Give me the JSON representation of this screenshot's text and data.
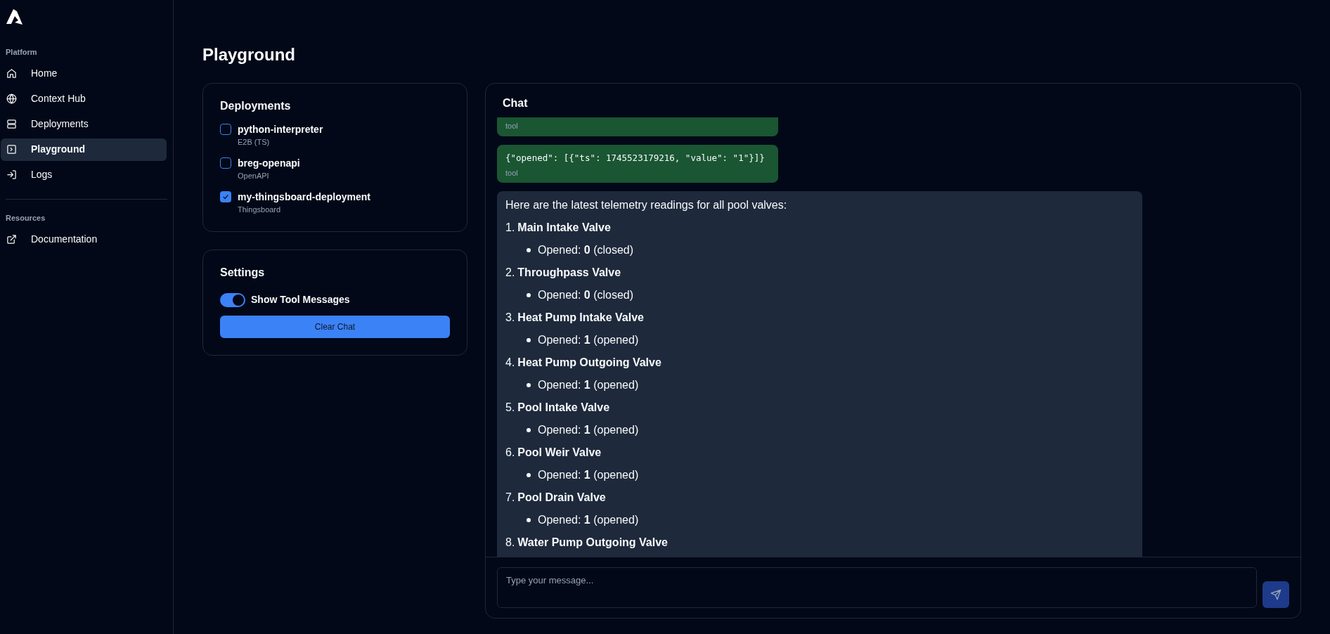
{
  "sidebar": {
    "sections": [
      {
        "title": "Platform",
        "items": [
          {
            "label": "Home",
            "kind": "home",
            "selected": false
          },
          {
            "label": "Context Hub",
            "kind": "globe",
            "selected": false
          },
          {
            "label": "Deployments",
            "kind": "server",
            "selected": false
          },
          {
            "label": "Playground",
            "kind": "terminal",
            "selected": true
          },
          {
            "label": "Logs",
            "kind": "login",
            "selected": false
          }
        ]
      },
      {
        "title": "Resources",
        "items": [
          {
            "label": "Documentation",
            "kind": "external",
            "selected": false
          }
        ]
      }
    ]
  },
  "page_title": "Playground",
  "deployments": {
    "title": "Deployments",
    "items": [
      {
        "name": "python-interpreter",
        "type": "E2B (TS)",
        "checked": false
      },
      {
        "name": "breg-openapi",
        "type": "OpenAPI",
        "checked": false
      },
      {
        "name": "my-thingsboard-deployment",
        "type": "Thingsboard",
        "checked": true
      }
    ]
  },
  "settings": {
    "title": "Settings",
    "toggle": {
      "label": "Show Tool Messages",
      "on": true
    },
    "button": "Clear Chat"
  },
  "chat": {
    "title": "Chat",
    "messages": [
      {
        "kind": "tool",
        "role": "tool"
      },
      {
        "kind": "tool",
        "content": "{\"opened\": [{\"ts\": 1745523179216, \"value\": \"1\"}]}",
        "role": "tool"
      },
      {
        "kind": "assistant",
        "intro": "Here are the latest telemetry readings for all pool valves:",
        "items": [
          {
            "number": "1.",
            "name": "Main Intake Valve",
            "detail": "Opened: **0** (closed)"
          },
          {
            "number": "2.",
            "name": "Throughpass Valve",
            "detail": "Opened: **0** (closed)"
          },
          {
            "number": "3.",
            "name": "Heat Pump Intake Valve",
            "detail": "Opened: **1** (opened)"
          },
          {
            "number": "4.",
            "name": "Heat Pump Outgoing Valve",
            "detail": "Opened: **1** (opened)"
          },
          {
            "number": "5.",
            "name": "Pool Intake Valve",
            "detail": "Opened: **1** (opened)"
          },
          {
            "number": "6.",
            "name": "Pool Weir Valve",
            "detail": "Opened: **1** (opened)"
          },
          {
            "number": "7.",
            "name": "Pool Drain Valve",
            "detail": "Opened: **1** (opened)"
          },
          {
            "number": "8.",
            "name": "Water Pump Outgoing Valve"
          }
        ]
      }
    ],
    "input": {
      "placeholder": "Type your message..."
    }
  }
}
